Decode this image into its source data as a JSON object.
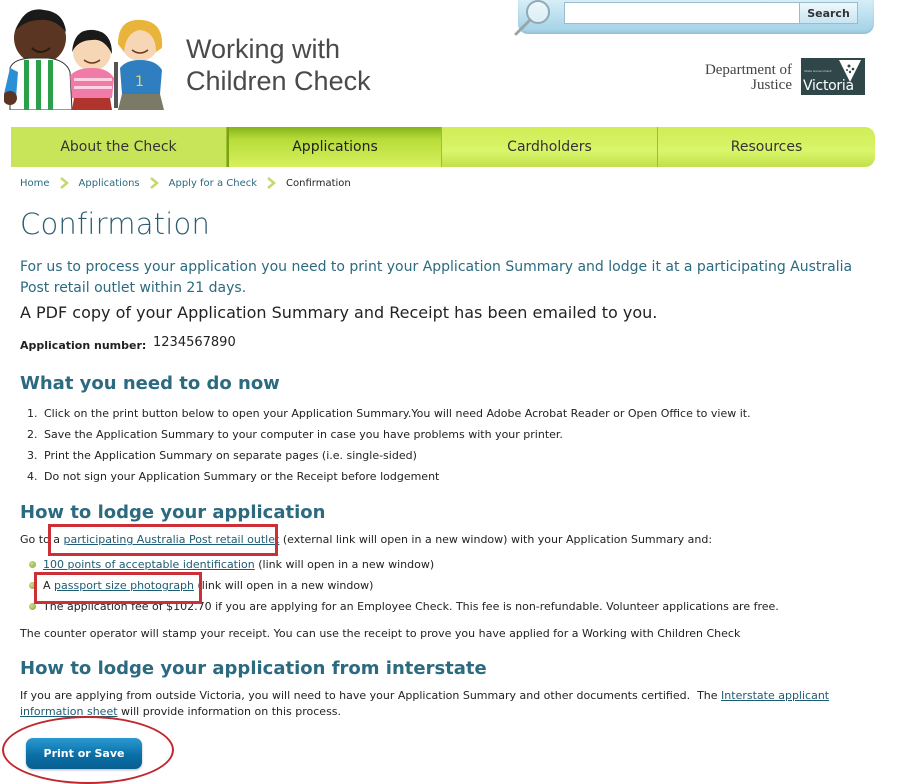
{
  "header": {
    "site_title_line1": "Working with",
    "site_title_line2": "Children Check",
    "search": {
      "placeholder": "",
      "value": "",
      "button_label": "Search"
    },
    "department": {
      "line1": "Department of",
      "line2": "Justice"
    },
    "government_logo": {
      "small_text": "State Government",
      "word": "Victoria"
    }
  },
  "nav": {
    "items": [
      {
        "label": "About the Check",
        "active": false
      },
      {
        "label": "Applications",
        "active": true
      },
      {
        "label": "Cardholders",
        "active": false
      },
      {
        "label": "Resources",
        "active": false
      }
    ]
  },
  "breadcrumb": {
    "items": [
      "Home",
      "Applications",
      "Apply for a Check",
      "Confirmation"
    ]
  },
  "main": {
    "title": "Confirmation",
    "intro": "For us to process your application you need to print your Application Summary and lodge it at a participating Australia Post retail outlet within 21 days.",
    "pdf_note": "A PDF copy of your Application Summary and Receipt has been emailed to you.",
    "application_number_label": "Application number:",
    "application_number": "1234567890",
    "section1": {
      "heading": "What you need to do now",
      "steps": [
        {
          "num": "1.",
          "text": "Click on the print button below to open your Application Summary.You will need Adobe Acrobat Reader or Open Office to view it."
        },
        {
          "num": "2.",
          "text": "Save the Application Summary to your computer in case you have problems with your printer."
        },
        {
          "num": "3.",
          "text": "Print the Application Summary on separate pages (i.e. single-sided)"
        },
        {
          "num": "4.",
          "text": "Do not sign your Application Summary or the Receipt before lodgement"
        }
      ]
    },
    "section2": {
      "heading": "How to lodge your application",
      "go_to_prefix": "Go to a ",
      "go_to_link": "participating Australia Post retail outlet",
      "go_to_suffix": " (external link will open in a new window) with your Application Summary and:",
      "bullets": [
        {
          "prefix": "",
          "link": "100 points of acceptable identification",
          "suffix": " (link will open in a new window)"
        },
        {
          "prefix": "A ",
          "link": "passport size photograph",
          "suffix": " (link will open in a new window)"
        },
        {
          "prefix": "The application fee of $102.70 if you are applying for an Employee Check. This fee is non-refundable. Volunteer applications are free.",
          "link": "",
          "suffix": ""
        }
      ],
      "counter_note": "The counter operator will stamp your receipt. You can use the receipt to prove you have applied for a Working with Children Check"
    },
    "section3": {
      "heading": "How to lodge your application from interstate",
      "text_prefix": "If you are applying from outside Victoria, you will need to have your Application Summary and other documents certified.  The ",
      "link": "Interstate applicant information sheet",
      "text_suffix": " will provide information on this process."
    },
    "print_button_label": "Print or Save"
  },
  "colors": {
    "heading": "#2c6a80",
    "nav_green": "#c8e559",
    "nav_active": "#86b31a",
    "annotation_red": "#cc2f36",
    "button_blue": "#0b6fa6"
  }
}
